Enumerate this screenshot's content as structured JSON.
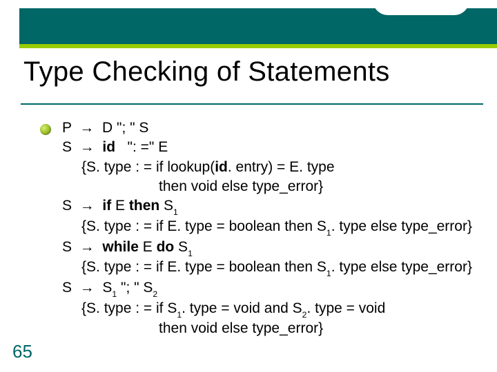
{
  "slide": {
    "title": "Type Checking of Statements",
    "page_number": "65",
    "accent_color": "#006666",
    "bullet_color": "#99cc00"
  },
  "grammar": {
    "r1": {
      "lhs": "P",
      "rhs_a": "D  \"; \"  S"
    },
    "r2": {
      "lhs": "S",
      "rhs_id": "id",
      "rhs_assign": "\": =\"  E",
      "sem_open": "{S. type : = if lookup(",
      "sem_mid_id": "id",
      "sem_mid": ". entry) = E. type",
      "sem_tail": "then void else type_error}"
    },
    "r3": {
      "lhs": "S",
      "kw_if": "if",
      "mid": "  E  ",
      "kw_then": "then",
      "tail": "  S",
      "sub": "1",
      "sem_a": "{S. type : = if E. type = boolean then S",
      "sem_sub": "1",
      "sem_b": ". type else type_error}"
    },
    "r4": {
      "lhs": "S",
      "kw_while": "while",
      "mid": "  E  ",
      "kw_do": "do",
      "tail": "  S",
      "sub": "1",
      "sem_a": "{S. type : = if E. type = boolean then S",
      "sem_sub": "1",
      "sem_b": ". type else type_error}"
    },
    "r5": {
      "lhs": "S",
      "rhs_a": "S",
      "sub1": "1",
      "mid": " \"; \"  S",
      "sub2": "2",
      "sem_a": "{S. type : = if S",
      "sem_sub1": "1",
      "sem_b": ". type = void and S",
      "sem_sub2": "2",
      "sem_c": ". type = void",
      "sem_tail": "then void else type_error}"
    }
  }
}
